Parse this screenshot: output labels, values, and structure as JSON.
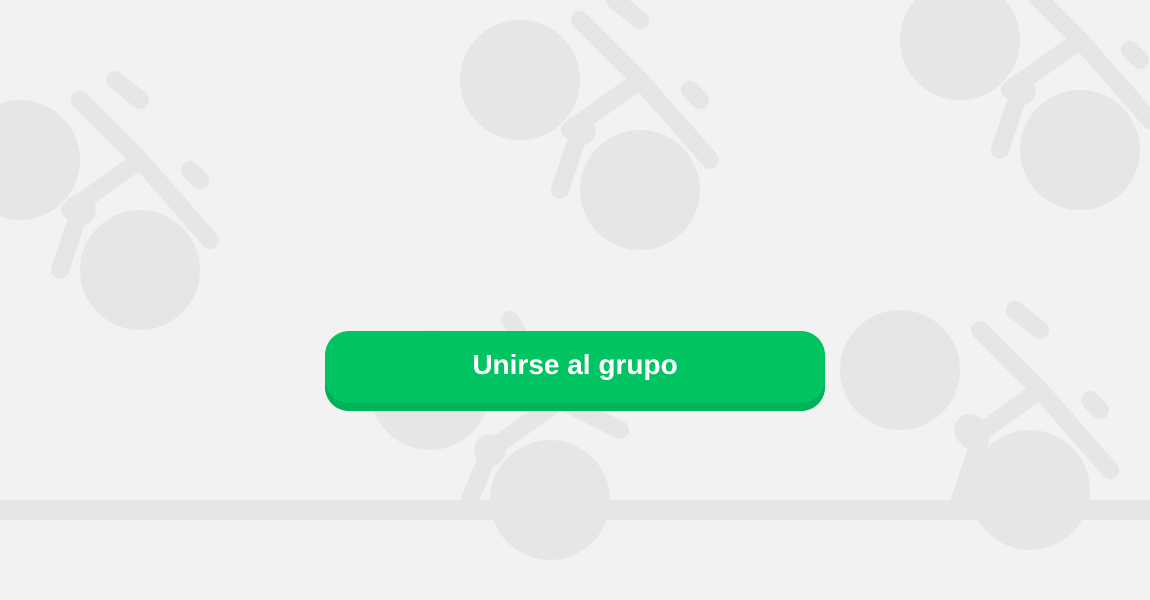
{
  "join_button": {
    "label": "Unirse al grupo"
  },
  "colors": {
    "background": "#f2f2f2",
    "pattern": "#e6e6e6",
    "button": "#00c462",
    "button_shadow": "#00b15a",
    "button_text": "#ffffff"
  },
  "background_pattern": {
    "icon": "bicycle-icon"
  }
}
